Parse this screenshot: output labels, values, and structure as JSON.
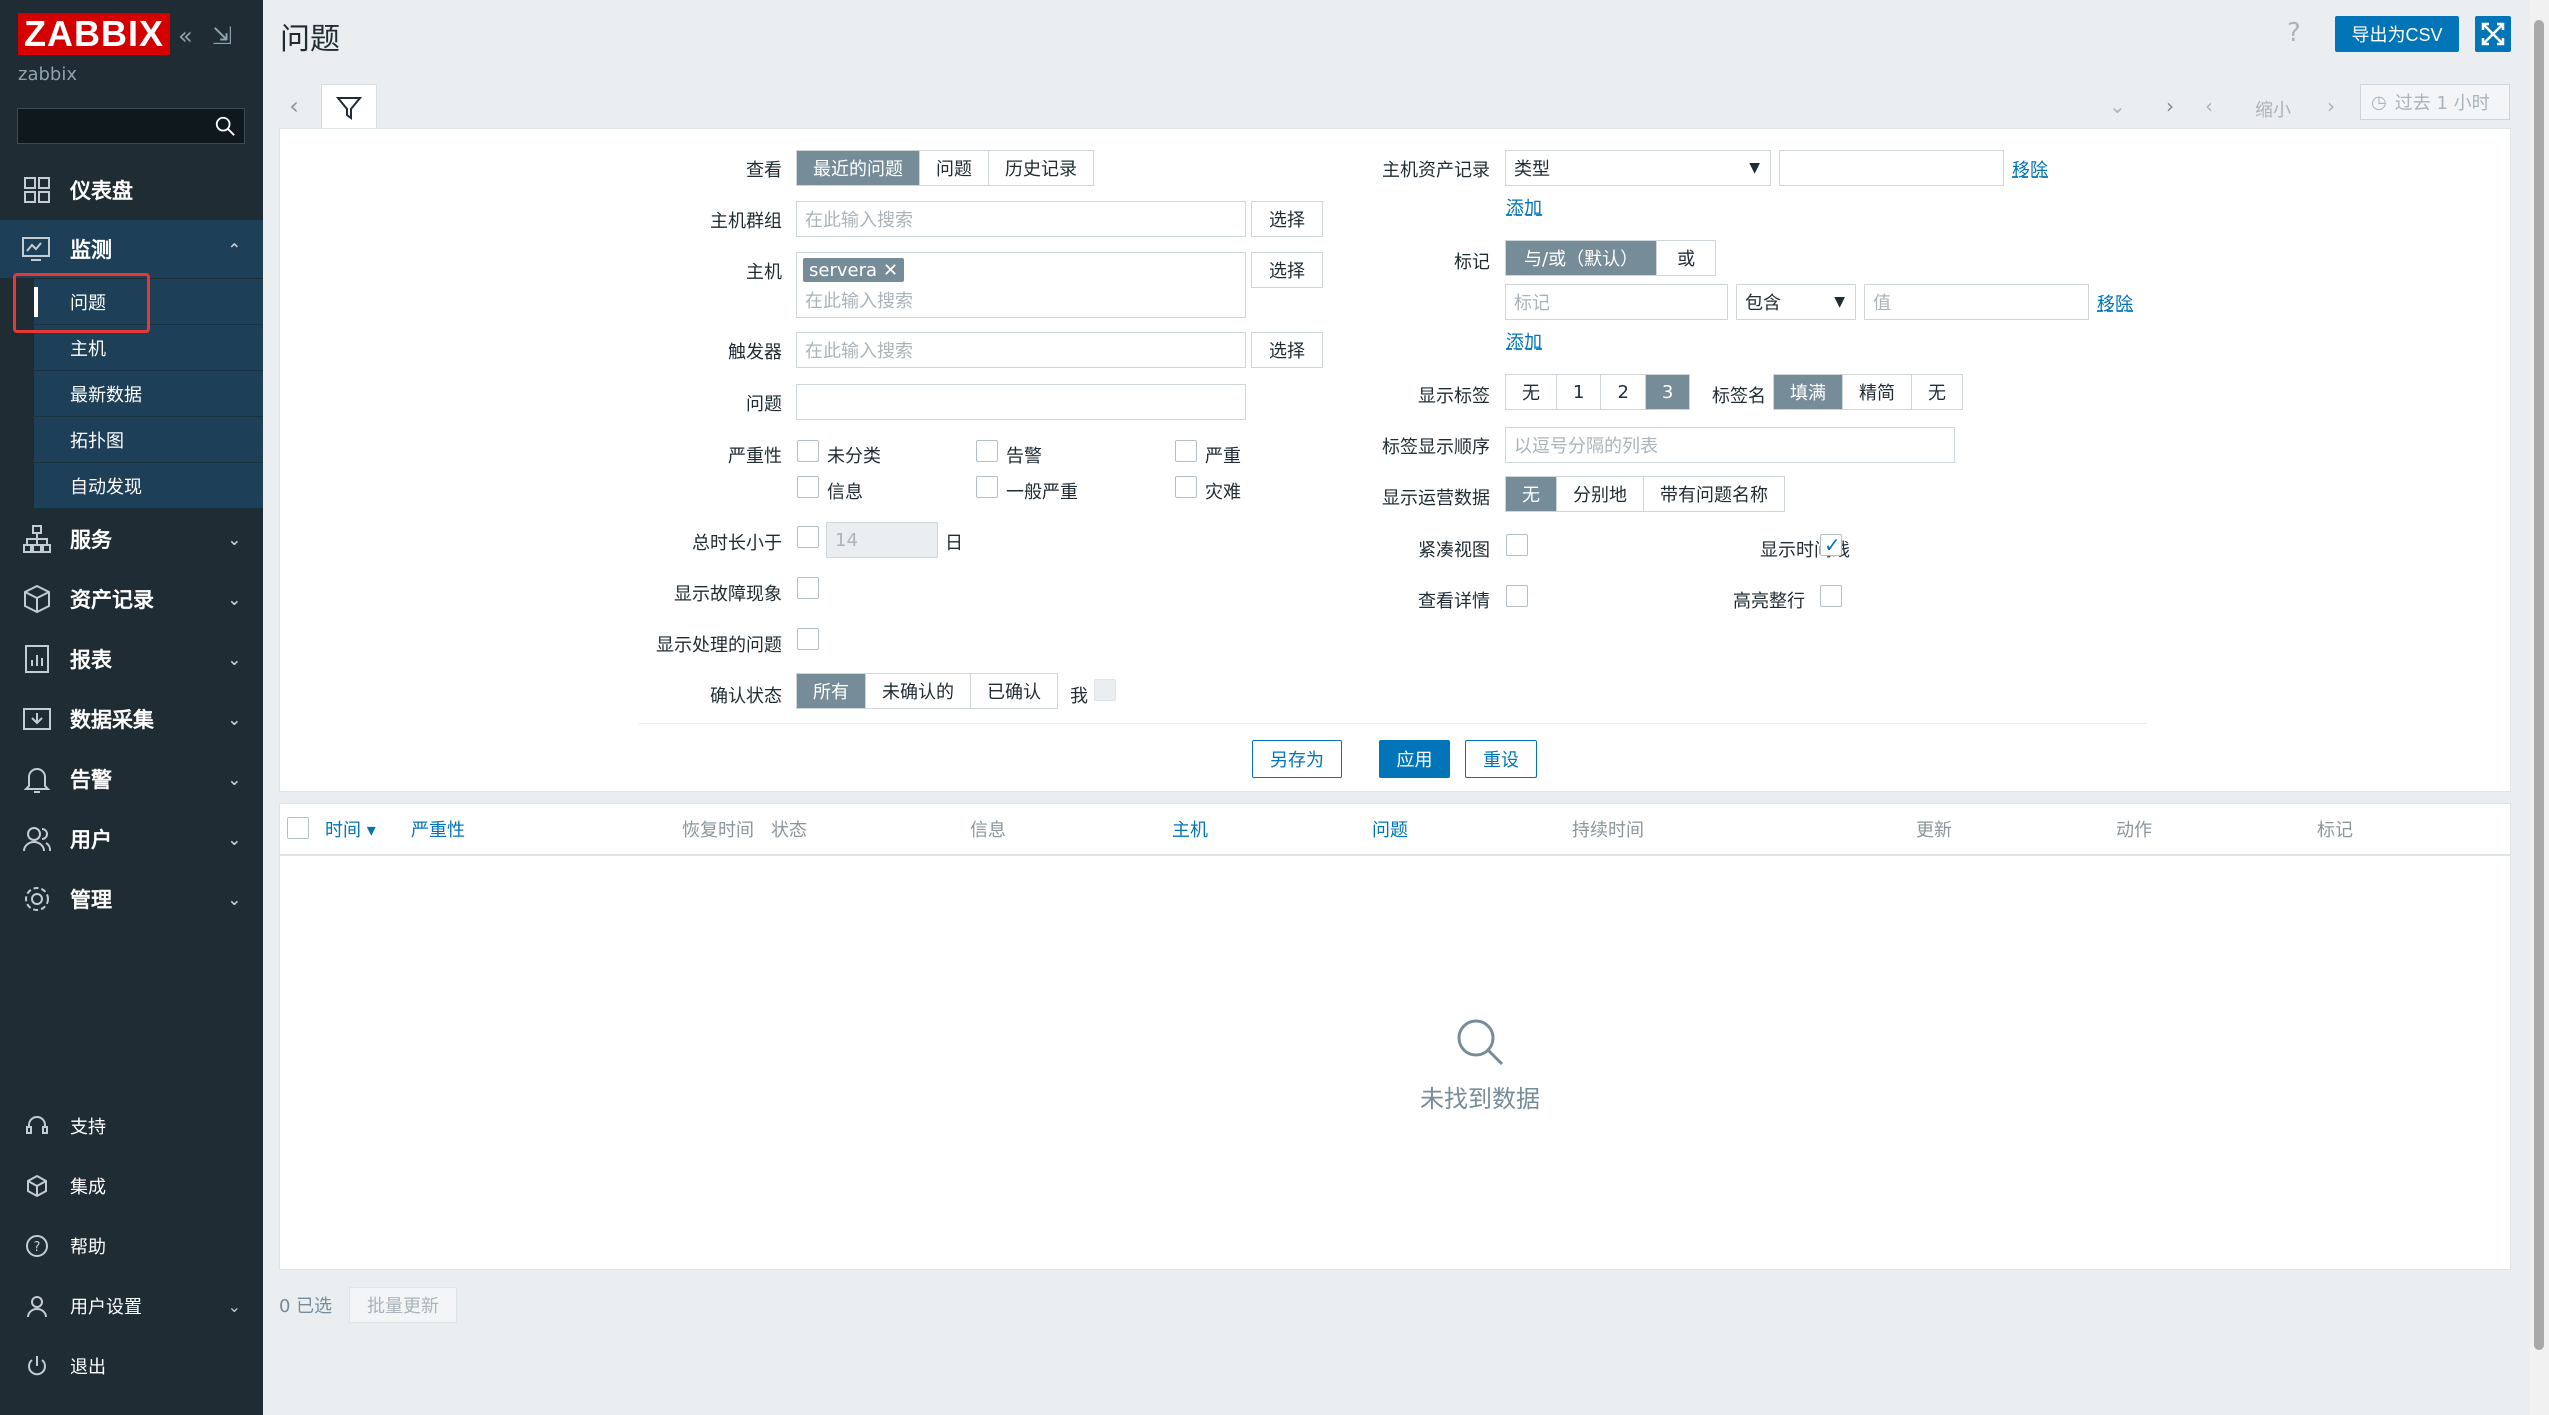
{
  "sidebar": {
    "logo": "ZABBIX",
    "server_name": "zabbix",
    "menu": {
      "dashboard": "仪表盘",
      "monitoring": "监测",
      "services": "服务",
      "inventory": "资产记录",
      "reports": "报表",
      "data_collection": "数据采集",
      "alerts": "告警",
      "users": "用户",
      "administration": "管理"
    },
    "submenu": [
      "问题",
      "主机",
      "最新数据",
      "拓扑图",
      "自动发现"
    ],
    "bottom": {
      "support": "支持",
      "integrations": "集成",
      "help": "帮助",
      "user_settings": "用户设置",
      "logout": "退出"
    }
  },
  "header": {
    "title": "问题",
    "help": "?",
    "export_csv": "导出为CSV"
  },
  "timebar": {
    "zoom_out": "缩小",
    "time_range": "过去 1 小时"
  },
  "filter": {
    "show_label": "查看",
    "show_options": [
      "最近的问题",
      "问题",
      "历史记录"
    ],
    "host_groups_label": "主机群组",
    "host_groups_placeholder": "在此输入搜索",
    "select": "选择",
    "hosts_label": "主机",
    "host_tag": "servera",
    "hosts_placeholder": "在此输入搜索",
    "triggers_label": "触发器",
    "triggers_placeholder": "在此输入搜索",
    "problem_label": "问题",
    "severity_label": "严重性",
    "severities": [
      "未分类",
      "告警",
      "严重",
      "信息",
      "一般严重",
      "灾难"
    ],
    "age_label": "总时长小于",
    "age_value": "14",
    "age_unit": "日",
    "show_symptoms_label": "显示故障现象",
    "show_suppressed_label": "显示处理的问题",
    "ack_label": "确认状态",
    "ack_options": [
      "所有",
      "未确认的",
      "已确认"
    ],
    "ack_me": "我",
    "inventory_label": "主机资产记录",
    "inventory_field": "类型",
    "remove": "移除",
    "add": "添加",
    "tags_label": "标记",
    "tag_operator_options": [
      "与/或（默认）",
      "或"
    ],
    "tag_placeholder": "标记",
    "tag_condition": "包含",
    "tag_value_placeholder": "值",
    "show_tags_label": "显示标签",
    "show_tags_options": [
      "无",
      "1",
      "2",
      "3"
    ],
    "tag_name_label": "标签名",
    "tag_name_options": [
      "填满",
      "精简",
      "无"
    ],
    "tag_priority_label": "标签显示顺序",
    "tag_priority_placeholder": "以逗号分隔的列表",
    "show_opdata_label": "显示运营数据",
    "opdata_options": [
      "无",
      "分别地",
      "带有问题名称"
    ],
    "compact_view_label": "紧凑视图",
    "show_timeline_label": "显示时间线",
    "details_label": "查看详情",
    "highlight_row_label": "高亮整行",
    "save_as": "另存为",
    "apply": "应用",
    "reset": "重设"
  },
  "table": {
    "columns": [
      "时间 ▾",
      "严重性",
      "恢复时间",
      "状态",
      "信息",
      "主机",
      "问题",
      "持续时间",
      "更新",
      "动作",
      "标记"
    ],
    "empty": "未找到数据"
  },
  "footer": {
    "selected": "0 已选",
    "mass_update": "批量更新"
  }
}
